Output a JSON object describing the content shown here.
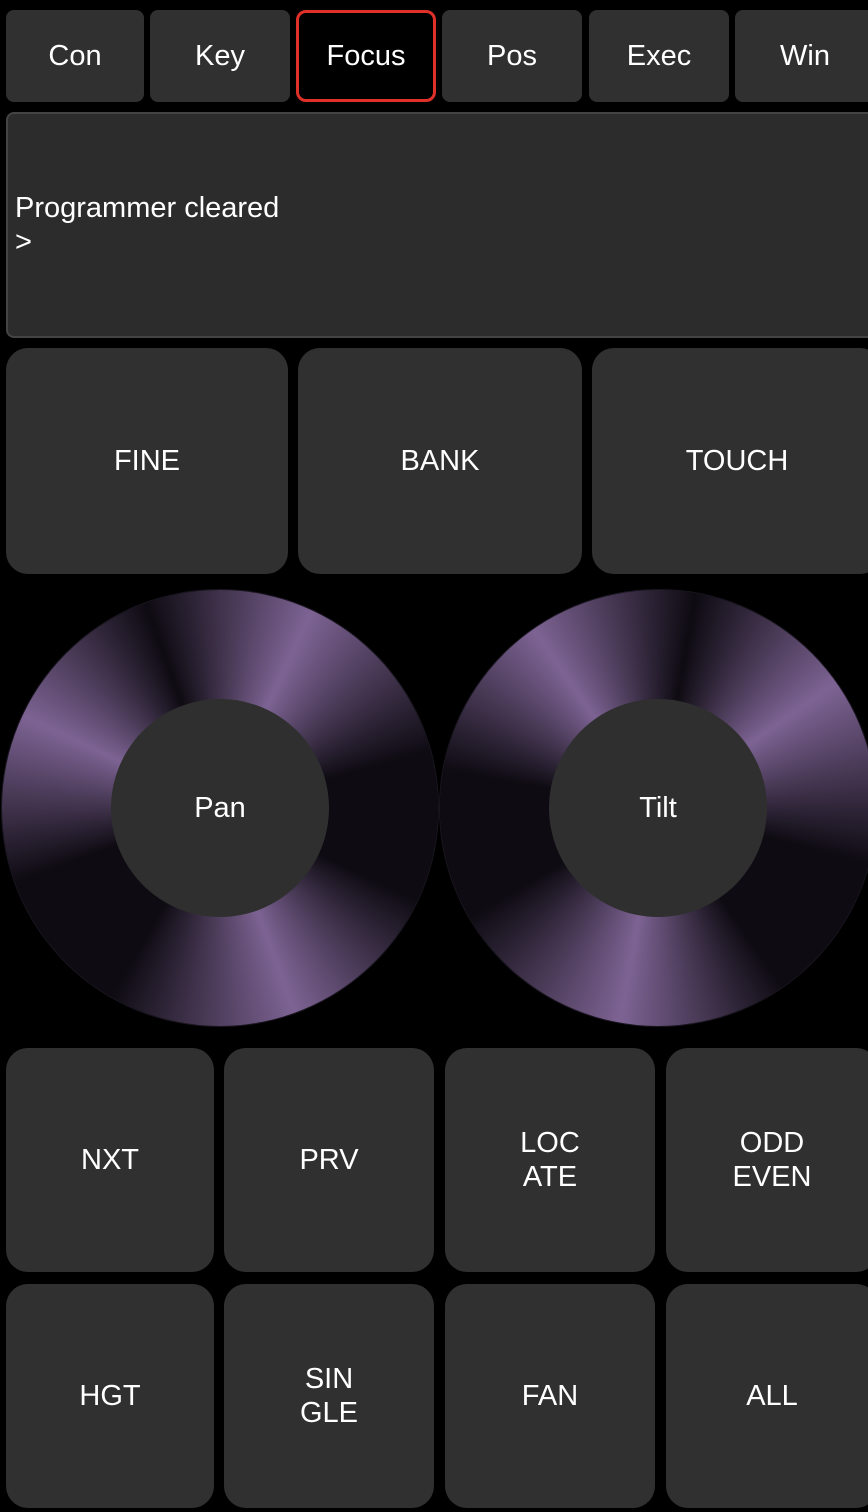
{
  "tabs": [
    {
      "label": "Con",
      "active": false
    },
    {
      "label": "Key",
      "active": false
    },
    {
      "label": "Focus",
      "active": true
    },
    {
      "label": "Pos",
      "active": false
    },
    {
      "label": "Exec",
      "active": false
    },
    {
      "label": "Win",
      "active": false
    }
  ],
  "console": {
    "message": "Programmer cleared",
    "prompt": ">"
  },
  "mode_buttons": [
    {
      "label": "FINE"
    },
    {
      "label": "BANK"
    },
    {
      "label": "TOUCH"
    }
  ],
  "wheels": {
    "pan": {
      "label": "Pan"
    },
    "tilt": {
      "label": "Tilt"
    }
  },
  "select_buttons": [
    {
      "line1": "NXT",
      "line2": ""
    },
    {
      "line1": "PRV",
      "line2": ""
    },
    {
      "line1": "LOC",
      "line2": "ATE"
    },
    {
      "line1": "ODD",
      "line2": "EVEN"
    },
    {
      "line1": "HGT",
      "line2": ""
    },
    {
      "line1": "SIN",
      "line2": "GLE"
    },
    {
      "line1": "FAN",
      "line2": ""
    },
    {
      "line1": "ALL",
      "line2": ""
    }
  ],
  "colors": {
    "background": "#000000",
    "button": "#303030",
    "active_tab_border": "#e0302a",
    "wheel_light": "#7d6393",
    "wheel_dark": "#0e0b12"
  }
}
